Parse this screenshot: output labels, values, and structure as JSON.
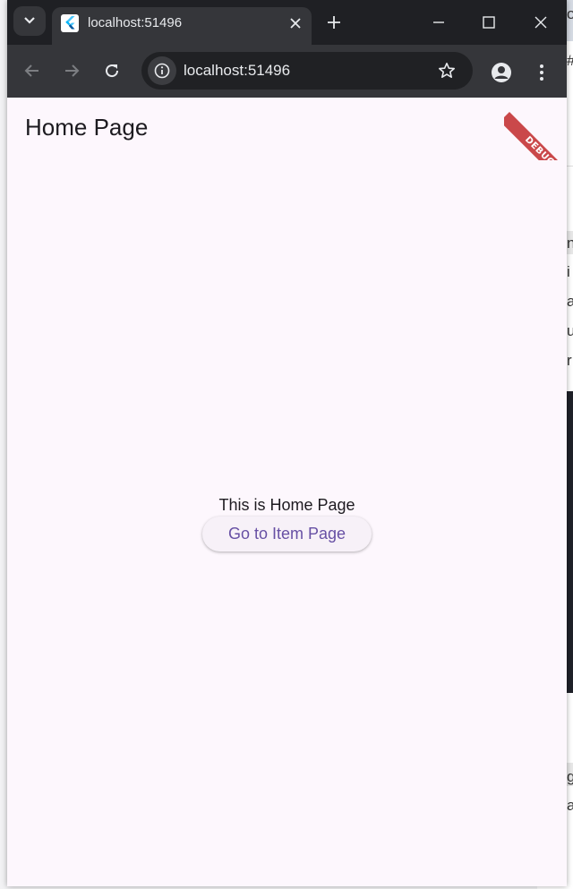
{
  "browser": {
    "tab_title": "localhost:51496",
    "address": "localhost:51496"
  },
  "app": {
    "title": "Home Page",
    "body_text": "This is Home Page",
    "button_label": "Go to Item Page",
    "debug_banner": "DEBUG"
  },
  "background_fragments": [
    "o",
    "#",
    "n",
    "i",
    "a",
    "u",
    "r",
    "a",
    "g",
    "a"
  ],
  "colors": {
    "tab_bar": "#1f2024",
    "toolbar": "#35363a",
    "app_background": "#fdf7fd",
    "button_text": "#6750a4",
    "debug_ribbon": "#b80d0d"
  },
  "icons": [
    "tab-list-icon",
    "flutter-favicon-icon",
    "close-icon",
    "plus-icon",
    "minimize-icon",
    "maximize-icon",
    "window-close-icon",
    "back-arrow-icon",
    "forward-arrow-icon",
    "reload-icon",
    "site-info-icon",
    "star-icon",
    "profile-icon",
    "more-vert-icon"
  ]
}
